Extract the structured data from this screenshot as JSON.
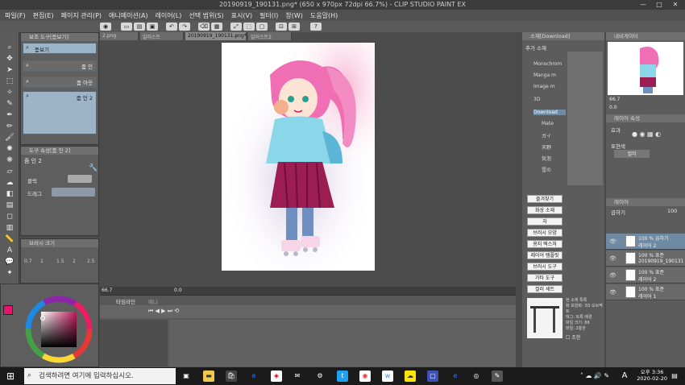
{
  "window": {
    "title": "20190919_190131.png* (650 x 970px 72dpi 66.7%) - CLIP STUDIO PAINT EX",
    "controls": [
      "—",
      "□",
      "✕"
    ]
  },
  "menu": [
    "파일(F)",
    "편집(E)",
    "페이지 관리(P)",
    "애니메이션(A)",
    "레이어(L)",
    "선택 범위(S)",
    "표시(V)",
    "필터(I)",
    "창(W)",
    "도움말(H)"
  ],
  "doc_tabs": [
    "2.png",
    "일러스트",
    "20190919_190131.png*",
    "일러스트2"
  ],
  "subtool_panel": {
    "header": "보조 도구[돋보기]",
    "items": [
      {
        "icon": "zoom-icon",
        "label": "돋보기",
        "selected": true
      },
      {
        "icon": "zoom-in-icon",
        "label": "줌 인",
        "selected": false
      },
      {
        "icon": "zoom-out-icon",
        "label": "줌 아웃",
        "selected": false
      },
      {
        "icon": "zoom-in-icon",
        "label": "줌 인 2",
        "selected": true
      }
    ]
  },
  "tool_property": {
    "header": "도구 속성[줌 인 2]",
    "name": "줌 인 2",
    "rows": [
      "클릭",
      "드래그"
    ]
  },
  "brush_size": {
    "header": "브러시 크기",
    "values": [
      "0.7",
      "1",
      "1.5",
      "2",
      "2.5"
    ]
  },
  "canvas": {
    "zoom": "66.7",
    "rotation": "0.0"
  },
  "timeline": {
    "tabs": [
      "타임라인",
      "애니"
    ]
  },
  "material_panel": {
    "header": "소재[Download]",
    "search_label": "추가 소재",
    "tree": [
      "Monochrom",
      "Manga m",
      "Image m",
      "3D",
      "Download",
      "Mate",
      "ガイ",
      "天野",
      "気泡",
      "雪の"
    ],
    "buttons": [
      "즐겨찾기",
      "화상 소재",
      "자",
      "브러시 모양",
      "용지 텍스처",
      "레이어 템플릿",
      "브러시 도구",
      "가타 도구",
      "컬러 세트"
    ],
    "material_info": [
      "현 소재 특록",
      "화 모양화: 3D 오브젝트",
      "태그: 트록 배경",
      "파일 크기: 88",
      "파일: 2층한"
    ],
    "checkbox_label": "조한"
  },
  "navigator": {
    "header": "내비게이터",
    "zoom": "66.7",
    "angle": "0.0"
  },
  "layer_property": {
    "header": "레이어 속성",
    "effect_label": "효과",
    "color_label": "표현색",
    "color_value": "컬러"
  },
  "layers_panel": {
    "header": "레이어",
    "blend": "곱하기",
    "opacity": "100",
    "rows": [
      {
        "pct": "100 % 곱하기",
        "name": "레이어 2",
        "selected": true
      },
      {
        "pct": "100 % 표준",
        "name": "20190919_190131",
        "selected": false
      },
      {
        "pct": "100 % 표준",
        "name": "레이어 2",
        "selected": false
      },
      {
        "pct": "100 % 표준",
        "name": "레이어 1",
        "selected": false
      }
    ]
  },
  "color": {
    "main": "#e8136f",
    "sub": "#ffffff",
    "hue_marker": "#c2185b"
  },
  "taskbar": {
    "search_placeholder": "검색하려면 여기에 입력하십시오.",
    "time": "오후 3:36",
    "date": "2020-02-20",
    "lang": "A"
  }
}
